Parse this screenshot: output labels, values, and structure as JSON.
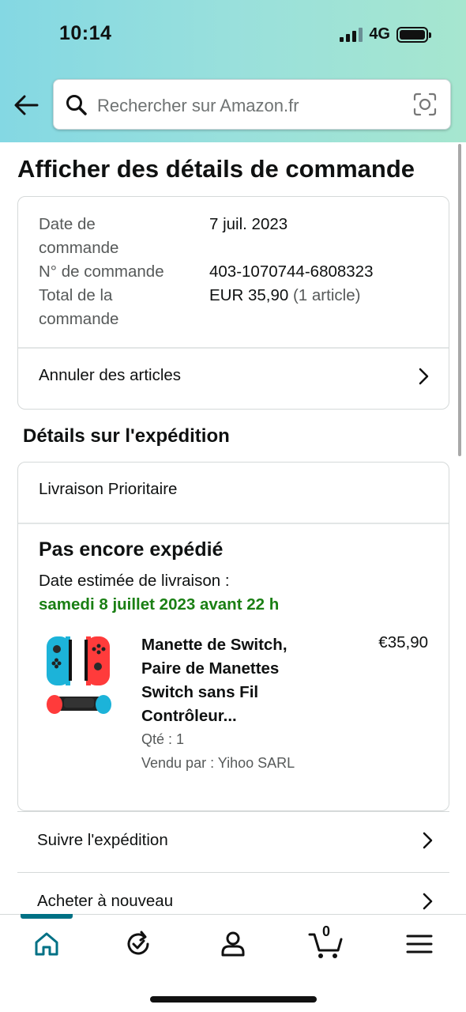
{
  "status_bar": {
    "time": "10:14",
    "network": "4G"
  },
  "search": {
    "placeholder": "Rechercher sur Amazon.fr"
  },
  "page": {
    "title": "Afficher des détails de commande"
  },
  "order_summary": {
    "date_label_1": "Date de",
    "date_label_2": "commande",
    "date_value": "7 juil. 2023",
    "number_label": "N° de commande",
    "number_value": "403-1070744-6808323",
    "total_label_1": "Total de la",
    "total_label_2": "commande",
    "total_value": "EUR 35,90",
    "total_items": "(1 article)",
    "cancel_label": "Annuler des articles"
  },
  "shipment": {
    "section_title": "Détails sur l'expédition",
    "delivery_type": "Livraison Prioritaire",
    "status": "Pas encore expédié",
    "eta_label": "Date estimée de livraison :",
    "eta_date": "samedi 8 juillet 2023 avant 22 h",
    "item": {
      "title_lines": [
        "Manette de Switch,",
        "Paire de Manettes",
        "Switch sans Fil",
        "Contrôleur..."
      ],
      "price": "€35,90",
      "qty": "Qté : 1",
      "seller": "Vendu par : Yihoo SARL"
    }
  },
  "actions": {
    "track": "Suivre l'expédition",
    "buy_again": "Acheter à nouveau"
  },
  "bottom_nav": {
    "items": [
      "home-icon",
      "refresh-icon",
      "account-icon",
      "cart-icon",
      "menu-icon"
    ],
    "cart_count": "0",
    "active": "home",
    "accent_color": "#007185"
  },
  "colors": {
    "delivery_green": "#1a7f14",
    "header_gradient_start": "#84d8e3",
    "header_gradient_end": "#a6e6cf"
  }
}
